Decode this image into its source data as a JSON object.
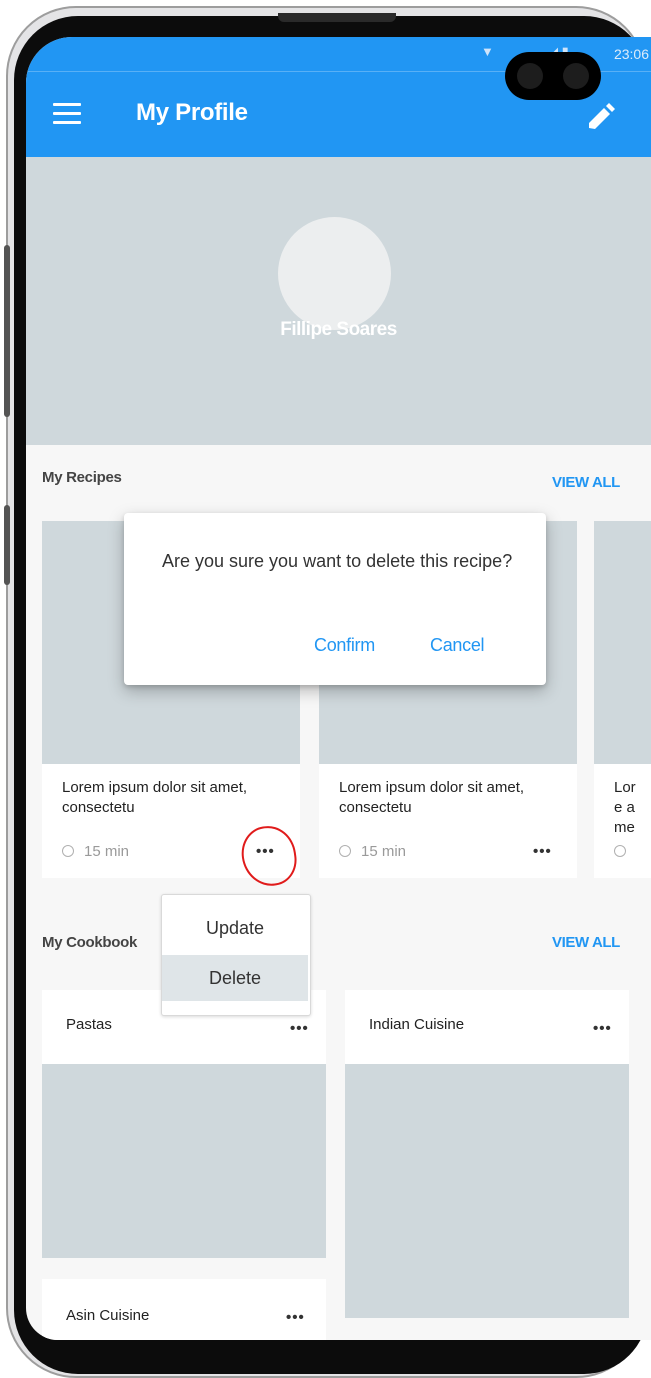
{
  "status_bar": {
    "time": "23:06"
  },
  "app_bar": {
    "title": "My Profile"
  },
  "profile": {
    "name": "Fillipe Soares"
  },
  "recipes_section": {
    "title": "My Recipes",
    "view_all": "VIEW ALL"
  },
  "recipes": [
    {
      "description": "Lorem ipsum dolor sit amet, consectetu",
      "time": "15 min",
      "more": "•••"
    },
    {
      "description": "Lorem ipsum dolor sit amet, consectetu",
      "time": "15 min",
      "more": "•••"
    },
    {
      "description": "Lore ame",
      "time": ""
    }
  ],
  "dialog": {
    "message": "Are you sure you want to delete this recipe?",
    "confirm": "Confirm",
    "cancel": "Cancel"
  },
  "context_menu": {
    "items": [
      "Update",
      "Delete"
    ],
    "highlighted": "Delete"
  },
  "cookbooks_section": {
    "title": "My Cookbook",
    "view_all": "VIEW ALL"
  },
  "cookbooks": [
    {
      "title": "Pastas",
      "more": "•••"
    },
    {
      "title": "Indian Cuisine",
      "more": "•••"
    },
    {
      "title": "Asin Cuisine",
      "more": "•••"
    }
  ],
  "colors": {
    "primary": "#2196f3",
    "placeholder": "#cfd8dc",
    "annotation": "#e01b1b"
  }
}
